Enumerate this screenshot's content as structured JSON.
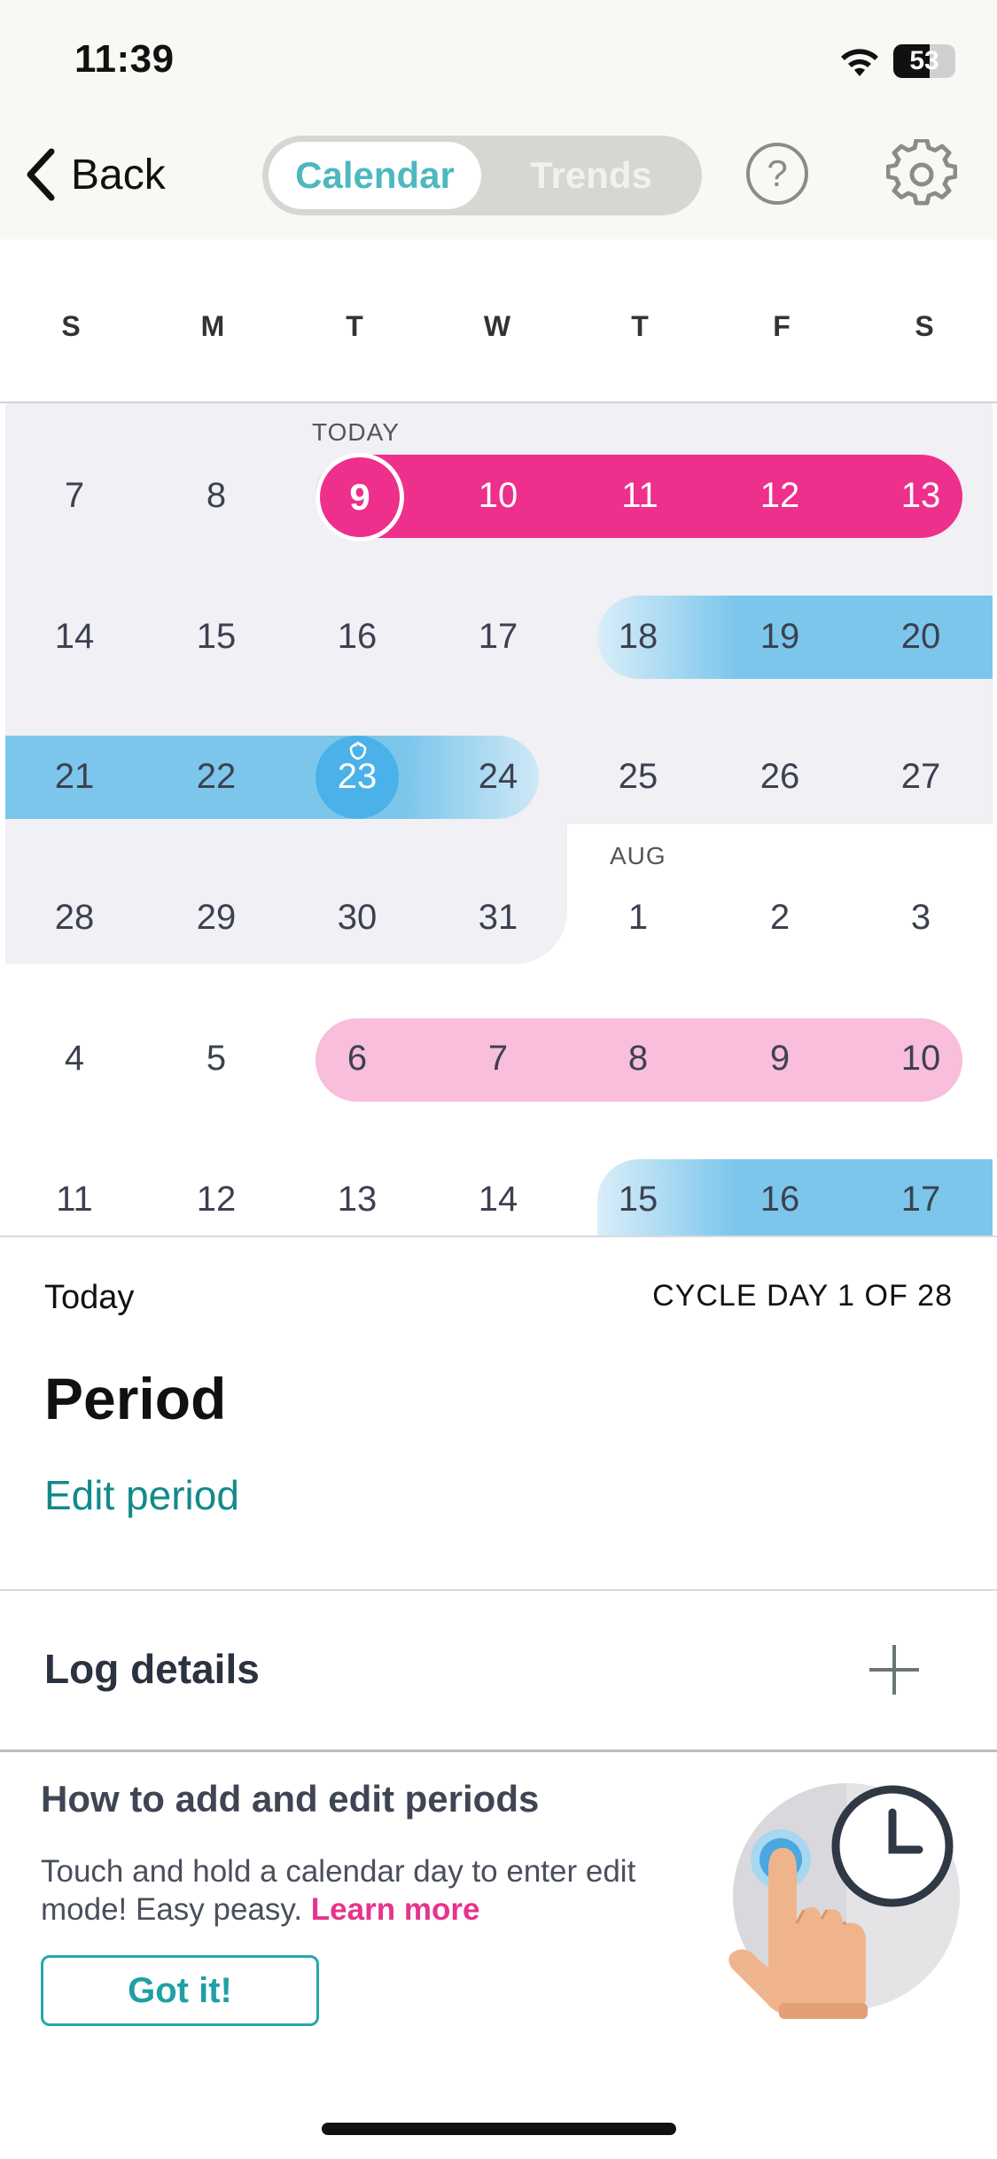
{
  "status_bar": {
    "time": "11:39",
    "battery": "53"
  },
  "header": {
    "back_label": "Back",
    "tabs": [
      {
        "label": "Calendar",
        "selected": true
      },
      {
        "label": "Trends",
        "selected": false
      }
    ],
    "help_label": "?"
  },
  "weekdays": [
    "S",
    "M",
    "T",
    "W",
    "T",
    "F",
    "S"
  ],
  "calendar": {
    "today_label": "TODAY",
    "month_label": "AUG",
    "weeks": [
      [
        "7",
        "8",
        "9",
        "10",
        "11",
        "12",
        "13"
      ],
      [
        "14",
        "15",
        "16",
        "17",
        "18",
        "19",
        "20"
      ],
      [
        "21",
        "22",
        "23",
        "24",
        "25",
        "26",
        "27"
      ],
      [
        "28",
        "29",
        "30",
        "31",
        "1",
        "2",
        "3"
      ],
      [
        "4",
        "5",
        "6",
        "7",
        "8",
        "9",
        "10"
      ],
      [
        "11",
        "12",
        "13",
        "14",
        "15",
        "16",
        "17"
      ]
    ]
  },
  "today_panel": {
    "label": "Today",
    "cycle_day": "CYCLE DAY 1 OF 28",
    "title": "Period",
    "edit_link": "Edit period"
  },
  "log_details": {
    "label": "Log details"
  },
  "tip_card": {
    "title": "How to add and edit periods",
    "body": "Touch and hold a calendar day to enter edit mode! Easy peasy.",
    "link": "Learn more",
    "button": "Got it!"
  },
  "colors": {
    "period": "#ee2f8b",
    "predicted_period": "#f8bedb",
    "fertile": "#7cc6ec",
    "ovulation": "#4ab2e8",
    "accent_teal": "#23a9ad"
  }
}
